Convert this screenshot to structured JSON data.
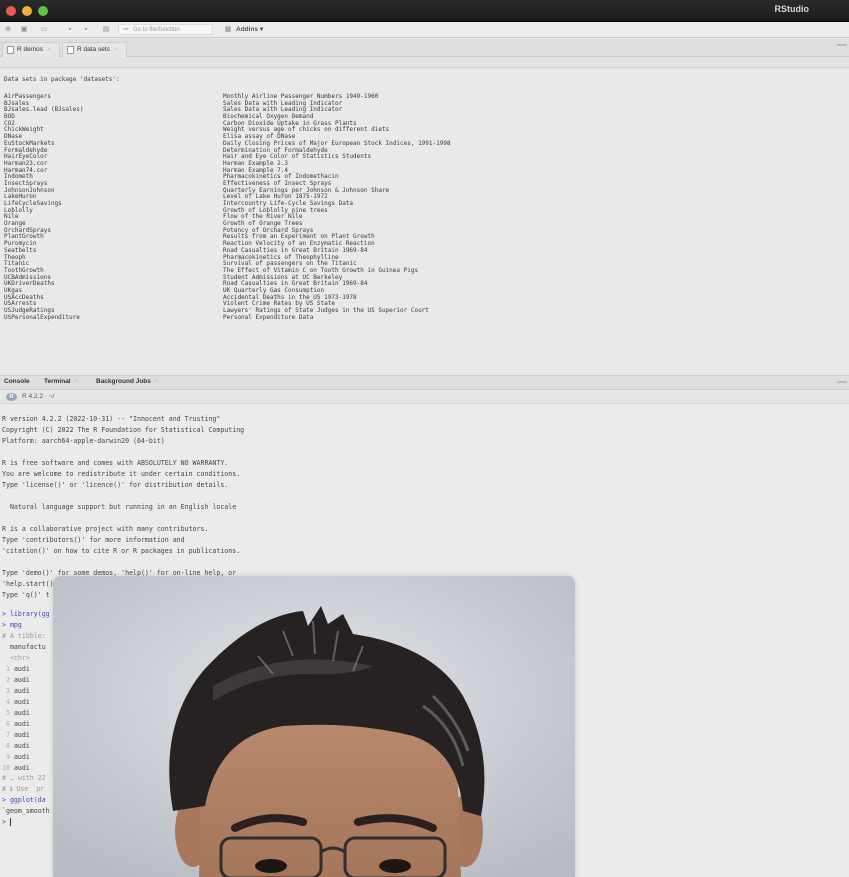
{
  "window": {
    "app_title": "RStudio"
  },
  "toolbar": {
    "goto_placeholder": "Go to file/function",
    "addins_label": "Addins ▾"
  },
  "source_tabs": [
    {
      "label": "R demos"
    },
    {
      "label": "R data sets"
    }
  ],
  "datasets": {
    "header": "Data sets in package 'datasets':",
    "rows": [
      {
        "name": "AirPassengers",
        "desc": "Monthly Airline Passenger Numbers 1949-1960"
      },
      {
        "name": "BJsales",
        "desc": "Sales Data with Leading Indicator"
      },
      {
        "name": "BJsales.lead (BJsales)",
        "desc": "Sales Data with Leading Indicator"
      },
      {
        "name": "BOD",
        "desc": "Biochemical Oxygen Demand"
      },
      {
        "name": "CO2",
        "desc": "Carbon Dioxide Uptake in Grass Plants"
      },
      {
        "name": "ChickWeight",
        "desc": "Weight versus age of chicks on different diets"
      },
      {
        "name": "DNase",
        "desc": "Elisa assay of DNase"
      },
      {
        "name": "EuStockMarkets",
        "desc": "Daily Closing Prices of Major European Stock Indices, 1991-1998"
      },
      {
        "name": "Formaldehyde",
        "desc": "Determination of Formaldehyde"
      },
      {
        "name": "HairEyeColor",
        "desc": "Hair and Eye Color of Statistics Students"
      },
      {
        "name": "Harman23.cor",
        "desc": "Harman Example 2.3"
      },
      {
        "name": "Harman74.cor",
        "desc": "Harman Example 7.4"
      },
      {
        "name": "Indometh",
        "desc": "Pharmacokinetics of Indomethacin"
      },
      {
        "name": "InsectSprays",
        "desc": "Effectiveness of Insect Sprays"
      },
      {
        "name": "JohnsonJohnson",
        "desc": "Quarterly Earnings per Johnson & Johnson Share"
      },
      {
        "name": "LakeHuron",
        "desc": "Level of Lake Huron 1875-1972"
      },
      {
        "name": "LifeCycleSavings",
        "desc": "Intercountry Life-Cycle Savings Data"
      },
      {
        "name": "Loblolly",
        "desc": "Growth of Loblolly pine trees"
      },
      {
        "name": "Nile",
        "desc": "Flow of the River Nile"
      },
      {
        "name": "Orange",
        "desc": "Growth of Orange Trees"
      },
      {
        "name": "OrchardSprays",
        "desc": "Potency of Orchard Sprays"
      },
      {
        "name": "PlantGrowth",
        "desc": "Results from an Experiment on Plant Growth"
      },
      {
        "name": "Puromycin",
        "desc": "Reaction Velocity of an Enzymatic Reaction"
      },
      {
        "name": "Seatbelts",
        "desc": "Road Casualties in Great Britain 1969-84"
      },
      {
        "name": "Theoph",
        "desc": "Pharmacokinetics of Theophylline"
      },
      {
        "name": "Titanic",
        "desc": "Survival of passengers on the Titanic"
      },
      {
        "name": "ToothGrowth",
        "desc": "The Effect of Vitamin C on Tooth Growth in Guinea Pigs"
      },
      {
        "name": "UCBAdmissions",
        "desc": "Student Admissions at UC Berkeley"
      },
      {
        "name": "UKDriverDeaths",
        "desc": "Road Casualties in Great Britain 1969-84"
      },
      {
        "name": "UKgas",
        "desc": "UK Quarterly Gas Consumption"
      },
      {
        "name": "USAccDeaths",
        "desc": "Accidental Deaths in the US 1973-1978"
      },
      {
        "name": "USArrests",
        "desc": "Violent Crime Rates by US State"
      },
      {
        "name": "USJudgeRatings",
        "desc": "Lawyers' Ratings of State Judges in the US Superior Court"
      },
      {
        "name": "USPersonalExpenditure",
        "desc": "Personal Expenditure Data"
      }
    ]
  },
  "console_tabs": [
    {
      "label": "Console"
    },
    {
      "label": "Terminal"
    },
    {
      "label": "Background Jobs"
    }
  ],
  "console_header": {
    "r_logo": "R",
    "version": "R 4.2.2 · ~/"
  },
  "console": {
    "startup": [
      "R version 4.2.2 (2022-10-31) -- \"Innocent and Trusting\"",
      "Copyright (C) 2022 The R Foundation for Statistical Computing",
      "Platform: aarch64-apple-darwin20 (64-bit)",
      "",
      "R is free software and comes with ABSOLUTELY NO WARRANTY.",
      "You are welcome to redistribute it under certain conditions.",
      "Type 'license()' or 'licence()' for distribution details.",
      "",
      "  Natural language support but running in an English locale",
      "",
      "R is a collaborative project with many contributors.",
      "Type 'contributors()' for more information and",
      "'citation()' on how to cite R or R packages in publications.",
      "",
      "Type 'demo()' for some demos, 'help()' for on-line help, or",
      "'help.start()",
      "Type 'q()' t"
    ],
    "cmd_library": "> library(gg",
    "cmd_mpg": "> mpg",
    "tibble_line": "# A tibble:",
    "col_header": "  manufactu",
    "col_type": "  <chr>",
    "rows": [
      {
        "num": "1",
        "val": "audi"
      },
      {
        "num": "2",
        "val": "audi"
      },
      {
        "num": "3",
        "val": "audi"
      },
      {
        "num": "4",
        "val": "audi"
      },
      {
        "num": "5",
        "val": "audi"
      },
      {
        "num": "6",
        "val": "audi"
      },
      {
        "num": "7",
        "val": "audi"
      },
      {
        "num": "8",
        "val": "audi"
      },
      {
        "num": "9",
        "val": "audi"
      },
      {
        "num": "10",
        "val": "audi"
      }
    ],
    "more_line": "# … with 22",
    "use_line": "# ℹ Use `pr",
    "cmd_ggplot": "> ggplot(da",
    "geom_line": "`geom_smooth",
    "final_prompt": ">"
  }
}
